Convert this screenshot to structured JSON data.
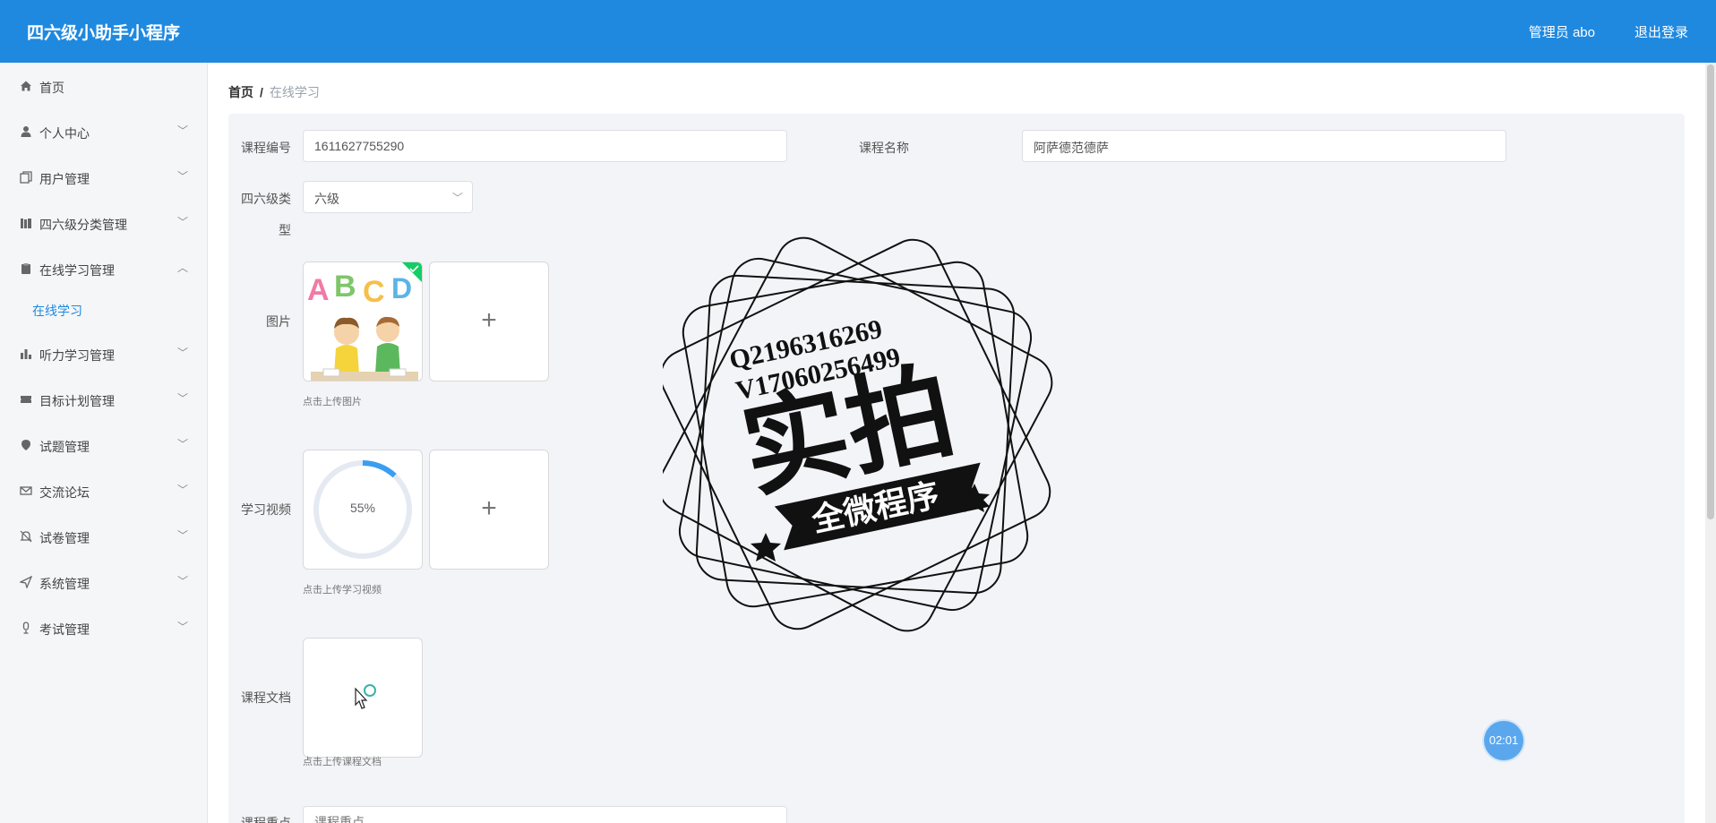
{
  "header": {
    "app_title": "四六级小助手小程序",
    "admin_label": "管理员 abo",
    "logout_label": "退出登录"
  },
  "sidebar": {
    "items": [
      {
        "label": "首页",
        "icon": "home-icon"
      },
      {
        "label": "个人中心",
        "icon": "user-icon"
      },
      {
        "label": "用户管理",
        "icon": "copy-icon"
      },
      {
        "label": "四六级分类管理",
        "icon": "books-icon"
      },
      {
        "label": "在线学习管理",
        "icon": "clipboard-icon",
        "expanded": true
      },
      {
        "label": "听力学习管理",
        "icon": "bar-chart-icon"
      },
      {
        "label": "目标计划管理",
        "icon": "ticket-icon"
      },
      {
        "label": "试题管理",
        "icon": "pin-icon"
      },
      {
        "label": "交流论坛",
        "icon": "mail-icon"
      },
      {
        "label": "试卷管理",
        "icon": "bell-icon"
      },
      {
        "label": "系统管理",
        "icon": "send-icon"
      },
      {
        "label": "考试管理",
        "icon": "mic-icon"
      }
    ],
    "subitems": [
      {
        "label": "在线学习"
      }
    ]
  },
  "breadcrumb": {
    "home": "首页",
    "separator": "/",
    "current": "在线学习"
  },
  "form": {
    "course_no_label": "课程编号",
    "course_no_value": "1611627755290",
    "course_name_label": "课程名称",
    "course_name_value": "阿萨德范德萨",
    "type_label_line1": "四六级类",
    "type_label_line2": "型",
    "type_value": "六级",
    "image_label": "图片",
    "image_hint": "点击上传图片",
    "image_letters": [
      "A",
      "B",
      "C",
      "D"
    ],
    "video_label": "学习视频",
    "video_progress_text": "55%",
    "video_progress": 0.55,
    "video_hint": "点击上传学习视频",
    "doc_label": "课程文档",
    "doc_hint": "点击上传课程文档",
    "focus_label": "课程重点",
    "focus_placeholder": "课程重点",
    "plus": "+"
  },
  "watermark": {
    "line1": "Q2196316269",
    "line2": "V17060256499",
    "big": "实拍",
    "banner": "全微程序"
  },
  "timer": "02:01",
  "colors": {
    "header_bg": "#1f89e0",
    "accent": "#1f89e0",
    "progress": "#3a9ef0",
    "success": "#13ce66"
  }
}
